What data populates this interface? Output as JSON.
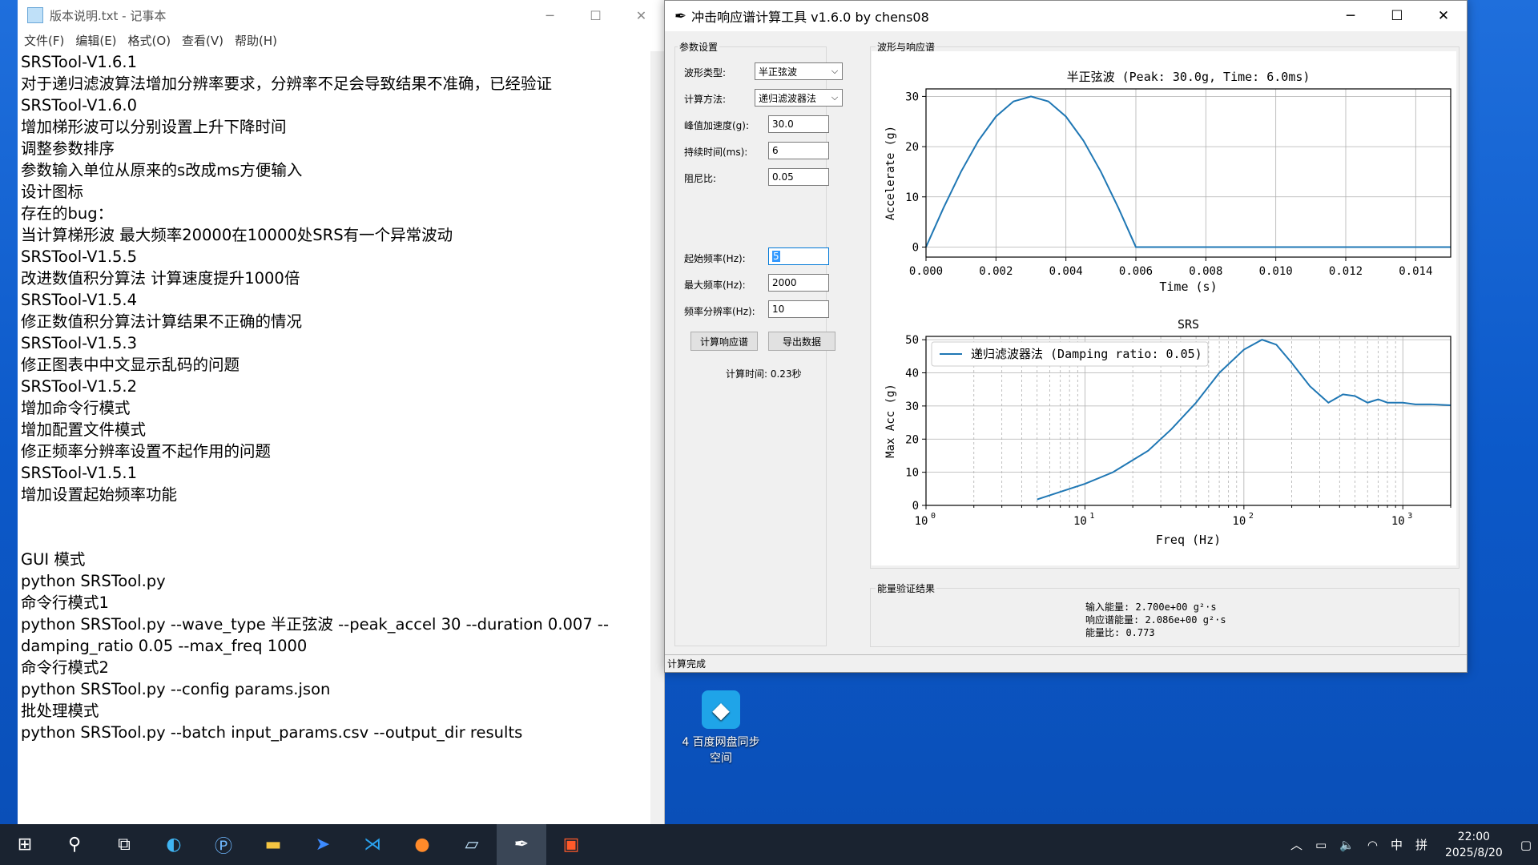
{
  "desktop": {
    "icon_label": "4 百度网盘同步\n空间"
  },
  "notepad": {
    "title": "版本说明.txt - 记事本",
    "menu": [
      "文件(F)",
      "编辑(E)",
      "格式(O)",
      "查看(V)",
      "帮助(H)"
    ],
    "content": "SRSTool-V1.6.1\n对于递归滤波算法增加分辨率要求，分辨率不足会导致结果不准确，已经验证\nSRSTool-V1.6.0\n增加梯形波可以分别设置上升下降时间\n调整参数排序\n参数输入单位从原来的s改成ms方便输入\n设计图标\n存在的bug：\n当计算梯形波 最大频率20000在10000处SRS有一个异常波动\nSRSTool-V1.5.5\n改进数值积分算法 计算速度提升1000倍\nSRSTool-V1.5.4\n修正数值积分算法计算结果不正确的情况\nSRSTool-V1.5.3\n修正图表中中文显示乱码的问题\nSRSTool-V1.5.2\n增加命令行模式\n增加配置文件模式\n修正频率分辨率设置不起作用的问题\nSRSTool-V1.5.1\n增加设置起始频率功能\n\n\nGUI 模式\npython SRSTool.py\n命令行模式1\npython SRSTool.py --wave_type 半正弦波 --peak_accel 30 --duration 0.007 --\ndamping_ratio 0.05 --max_freq 1000\n命令行模式2\npython SRSTool.py --config params.json\n批处理模式\npython SRSTool.py --batch input_params.csv --output_dir results"
  },
  "srs": {
    "title": "冲击响应谱计算工具 v1.6.0 by chens08",
    "params_group": "参数设置",
    "plots_group": "波形与响应谱",
    "energy_group": "能量验证结果",
    "fields": {
      "wave_type_label": "波形类型:",
      "wave_type_value": "半正弦波",
      "method_label": "计算方法:",
      "method_value": "递归滤波器法",
      "peak_label": "峰值加速度(g):",
      "peak_value": "30.0",
      "duration_label": "持续时间(ms):",
      "duration_value": "6",
      "damping_label": "阻尼比:",
      "damping_value": "0.05",
      "start_freq_label": "起始频率(Hz):",
      "start_freq_value": "5",
      "max_freq_label": "最大频率(Hz):",
      "max_freq_value": "2000",
      "res_label": "频率分辨率(Hz):",
      "res_value": "10"
    },
    "buttons": {
      "compute": "计算响应谱",
      "export": "导出数据"
    },
    "calc_time": "计算时间: 0.23秒",
    "energy": {
      "input": "输入能量: 2.700e+00 g²·s",
      "response": "响应谱能量: 2.086e+00 g²·s",
      "ratio": "能量比: 0.773"
    },
    "status": "计算完成"
  },
  "chart_data": [
    {
      "type": "line",
      "title": "半正弦波 (Peak: 30.0g, Time: 6.0ms)",
      "xlabel": "Time (s)",
      "ylabel": "Accelerate (g)",
      "xlim": [
        0,
        0.015
      ],
      "ylim": [
        -2,
        31.5
      ],
      "xticks": [
        "0.000",
        "0.002",
        "0.004",
        "0.006",
        "0.008",
        "0.010",
        "0.012",
        "0.014"
      ],
      "yticks": [
        "0",
        "10",
        "20",
        "30"
      ],
      "grid": true,
      "series": [
        {
          "x": [
            0,
            0.0005,
            0.001,
            0.0015,
            0.002,
            0.0025,
            0.003,
            0.0035,
            0.004,
            0.0045,
            0.005,
            0.0055,
            0.006,
            0.015
          ],
          "y": [
            0,
            7.8,
            15,
            21.2,
            26,
            29,
            30,
            29,
            26,
            21.2,
            15,
            7.8,
            0,
            0
          ]
        }
      ],
      "color": "#1f77b4"
    },
    {
      "type": "line",
      "title": "SRS",
      "xlabel": "Freq (Hz)",
      "ylabel": "Max Acc (g)",
      "xscale": "log",
      "xlim": [
        1,
        2000
      ],
      "ylim": [
        0,
        51
      ],
      "xticks": [
        "10^0",
        "10^1",
        "10^2",
        "10^3"
      ],
      "yticks": [
        "0",
        "10",
        "20",
        "30",
        "40",
        "50"
      ],
      "grid": true,
      "legend": "top-left",
      "series": [
        {
          "name": "递归滤波器法 (Damping ratio: 0.05)",
          "x": [
            5,
            10,
            15,
            25,
            35,
            50,
            70,
            100,
            130,
            160,
            200,
            260,
            340,
            420,
            500,
            600,
            700,
            800,
            1000,
            1200,
            1500,
            2000
          ],
          "y": [
            1.8,
            6.5,
            10,
            16.5,
            23,
            31,
            40,
            47,
            50,
            48.5,
            43,
            36,
            31,
            33.5,
            33,
            31,
            32,
            31,
            31,
            30.5,
            30.5,
            30.2
          ]
        }
      ],
      "color": "#1f77b4"
    }
  ],
  "taskbar": {
    "time": "22:00",
    "date": "2025/8/20",
    "ime": "中"
  }
}
